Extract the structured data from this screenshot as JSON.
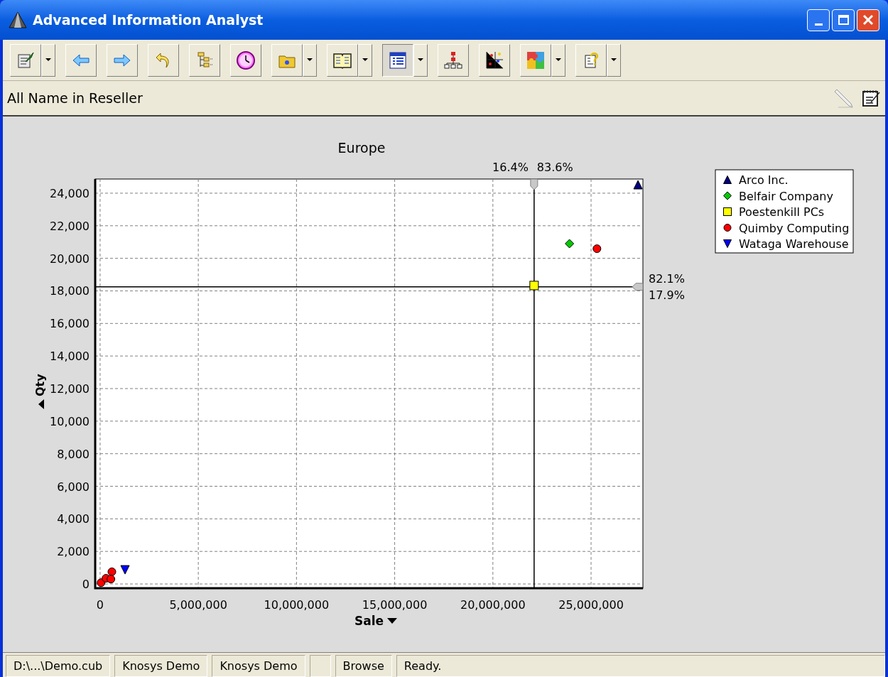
{
  "window": {
    "title": "Advanced Information Analyst"
  },
  "toolbar": [
    {
      "kind": "notepad",
      "dropdown": true,
      "pressed": false
    },
    {
      "kind": "back",
      "dropdown": false,
      "pressed": false
    },
    {
      "kind": "forward",
      "dropdown": false,
      "pressed": false
    },
    {
      "kind": "undo",
      "dropdown": false,
      "pressed": false
    },
    {
      "kind": "tree",
      "dropdown": false,
      "pressed": false
    },
    {
      "kind": "clock",
      "dropdown": false,
      "pressed": false
    },
    {
      "kind": "folder",
      "dropdown": true,
      "pressed": false
    },
    {
      "kind": "book",
      "dropdown": true,
      "pressed": false
    },
    {
      "kind": "table",
      "dropdown": true,
      "pressed": true
    },
    {
      "kind": "hierarchy",
      "dropdown": false,
      "pressed": false
    },
    {
      "kind": "scatter",
      "dropdown": false,
      "pressed": false
    },
    {
      "kind": "puzzle",
      "dropdown": true,
      "pressed": false
    },
    {
      "kind": "help",
      "dropdown": true,
      "pressed": false
    }
  ],
  "view_title": "All Name in Reseller",
  "chart": {
    "chart_data": {
      "type": "scatter",
      "title": "Europe",
      "xlabel": "Sale",
      "ylabel": "Qty",
      "xlim": [
        -250000,
        27640000
      ],
      "ylim": [
        -260,
        24870
      ],
      "xticks": [
        {
          "value": 0,
          "label": "0"
        },
        {
          "value": 5000000,
          "label": "5,000,000"
        },
        {
          "value": 10000000,
          "label": "10,000,000"
        },
        {
          "value": 15000000,
          "label": "15,000,000"
        },
        {
          "value": 20000000,
          "label": "20,000,000"
        },
        {
          "value": 25000000,
          "label": "25,000,000"
        }
      ],
      "yticks": [
        {
          "value": 0,
          "label": "0"
        },
        {
          "value": 2000,
          "label": "2,000"
        },
        {
          "value": 4000,
          "label": "4,000"
        },
        {
          "value": 6000,
          "label": "6,000"
        },
        {
          "value": 8000,
          "label": "8,000"
        },
        {
          "value": 10000,
          "label": "10,000"
        },
        {
          "value": 12000,
          "label": "12,000"
        },
        {
          "value": 14000,
          "label": "14,000"
        },
        {
          "value": 16000,
          "label": "16,000"
        },
        {
          "value": 18000,
          "label": "18,000"
        },
        {
          "value": 20000,
          "label": "20,000"
        },
        {
          "value": 22000,
          "label": "22,000"
        },
        {
          "value": 24000,
          "label": "24,000"
        }
      ],
      "series": [
        {
          "name": "Arco Inc.",
          "color": "#000080",
          "marker": "triangle",
          "x": [
            27390000
          ],
          "values": [
            24520
          ]
        },
        {
          "name": "Belfair Company",
          "color": "#00cc00",
          "marker": "diamond",
          "x": [
            23900000
          ],
          "values": [
            20900
          ]
        },
        {
          "name": "Poestenkill PCs",
          "color": "#ffff00",
          "marker": "square",
          "x": [
            22100000
          ],
          "values": [
            18330
          ]
        },
        {
          "name": "Quimby Computing",
          "color": "#ff0000",
          "marker": "circle",
          "x": [
            25300000,
            50000,
            300000,
            null,
            600000,
            550000
          ],
          "values": [
            20590,
            80,
            350,
            null,
            750,
            300
          ]
        },
        {
          "name": "Wataga Warehouse",
          "color": "#0000ff",
          "marker": "triangle-down",
          "x": [
            1270000
          ],
          "values": [
            870
          ]
        }
      ],
      "ref_lines": [
        {
          "axis": "x",
          "value": 22100000
        },
        {
          "axis": "y",
          "value": 18250
        }
      ],
      "grid": true,
      "legend": "right"
    },
    "x_split_labels": [
      "16.4%",
      "83.6%"
    ],
    "y_split_labels": [
      "82.1%",
      "17.9%"
    ]
  },
  "status_bar": [
    {
      "text": "D:\\...\\Demo.cub",
      "kind": "file"
    },
    {
      "text": "Knosys Demo",
      "kind": "user"
    },
    {
      "text": "Knosys Demo",
      "kind": "user"
    },
    {
      "text": "Browse",
      "kind": "mode"
    },
    {
      "text": "Ready.",
      "kind": "status"
    }
  ]
}
